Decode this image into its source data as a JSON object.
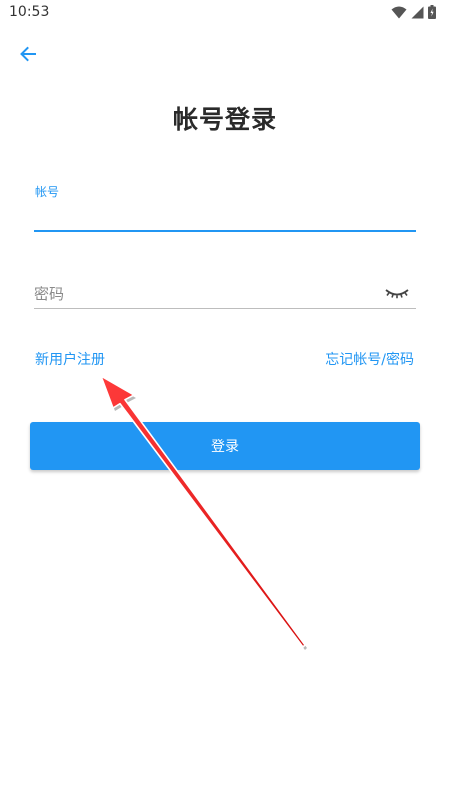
{
  "status_bar": {
    "time": "10:53",
    "icons": [
      "wifi-icon",
      "signal-icon",
      "battery-icon"
    ]
  },
  "header": {
    "back_icon": "arrow-left-icon",
    "title": "帐号登录"
  },
  "form": {
    "account": {
      "label": "帐号",
      "value": ""
    },
    "password": {
      "placeholder": "密码",
      "toggle_icon": "eye-closed-icon"
    }
  },
  "links": {
    "register": "新用户注册",
    "forgot": "忘记帐号/密码"
  },
  "login_button": {
    "label": "登录"
  },
  "colors": {
    "accent": "#2196f3",
    "title": "#2a2a2a",
    "annotation_arrow": "#ee1c1c"
  }
}
